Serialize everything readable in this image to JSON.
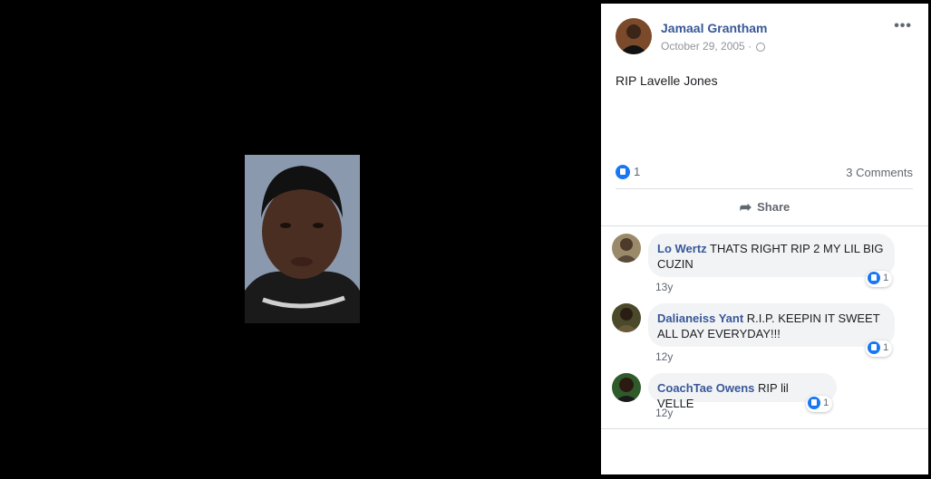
{
  "post": {
    "author": "Jamaal Grantham",
    "date": "October 29, 2005 ·",
    "menu_icon": "•••",
    "text": "RIP Lavelle Jones",
    "like_count": "1",
    "comments_count": "3 Comments",
    "share_label": "Share"
  },
  "comments": [
    {
      "name": "Lo Wertz",
      "text": "THATS RIGHT RIP 2 MY LIL BIG CUZIN",
      "time": "13y",
      "reactions": "1"
    },
    {
      "name": "Dalianeiss Yant",
      "text": "R.I.P. KEEPIN IT SWEET ALL DAY EVERYDAY!!!",
      "time": "12y",
      "reactions": "1"
    },
    {
      "name": "CoachTae Owens",
      "text": "RIP lil VELLE",
      "time": "12y",
      "reactions": "1"
    }
  ],
  "colors": {
    "accent": "#385898",
    "like_blue": "#1877f2",
    "bubble": "#f2f3f5"
  }
}
